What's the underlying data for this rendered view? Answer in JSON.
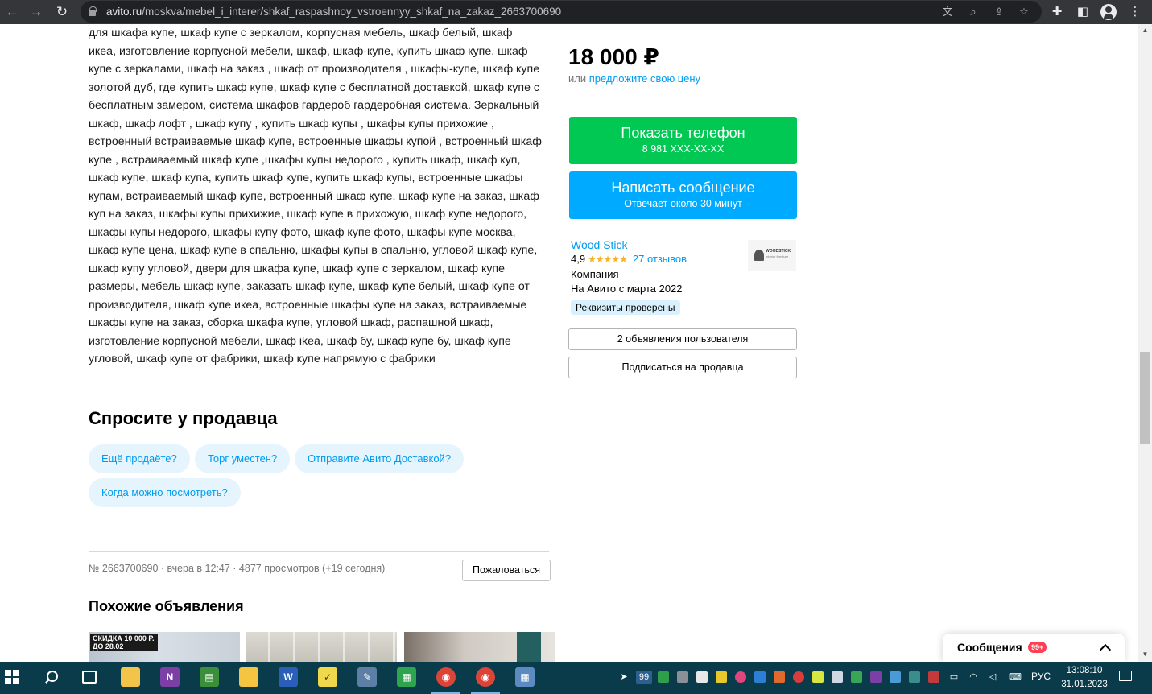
{
  "browser": {
    "url_host": "avito.ru",
    "url_path": "/moskva/mebel_i_interer/shkaf_raspashnoy_vstroennyy_shkaf_na_zakaz_2663700690",
    "icons": [
      "back-arrow-icon",
      "forward-arrow-icon",
      "reload-icon",
      "lock-icon",
      "translate-icon",
      "zoom-icon",
      "share-icon",
      "star-icon",
      "extensions-icon",
      "sidebar-icon",
      "profile-icon",
      "menu-icon"
    ]
  },
  "description": {
    "lines": [
      "для шкафа купе, шкаф купе с зеркалом, корпусная мебель, шкаф белый, шкаф",
      "икеа, изготовление корпусной мебели, шкаф, шкаф-купе, купить шкаф купе, шкаф",
      "купе с зеркалами, шкаф на заказ , шкаф от производителя , шкафы-купе, шкаф купе",
      "золотой дуб, где купить шкаф купе, шкаф купе с бесплатной доставкой, шкаф купе с",
      "бесплатным замером, система шкафов гардероб гардеробная система. Зеркальный",
      "шкаф, шкаф лофт , шкаф купу , купить шкаф купы , шкафы купы прихожие ,",
      "встроенный встраиваемые шкаф купе, встроенные шкафы купой , встроенный шкаф",
      "купе , встраиваемый шкаф купе ,шкафы купы недорого , купить шкаф, шкаф куп,",
      "шкаф купе, шкаф купа, купить шкаф купе, купить шкаф купы, встроенные шкафы",
      "купам, встраиваемый шкаф купе, встроенный шкаф купе, шкаф купе на заказ, шкаф",
      "куп на заказ, шкафы купы прихижие, шкаф купе в прихожую, шкаф купе недорого,",
      "шкафы купы недорого, шкафы купу фото, шкаф купе фото, шкафы купе москва,",
      "шкаф купе цена, шкаф купе в спальню, шкафы купы в спальню, угловой шкаф купе,",
      "шкаф купу угловой, двери для шкафа купе, шкаф купе с зеркалом, шкаф купе",
      "размеры, мебель шкаф купе, заказать шкаф купе, шкаф купе белый, шкаф купе от",
      "производителя, шкаф купе икеа, встроенные шкафы купе на заказ, встраиваемые",
      "шкафы купе на заказ, сборка шкафа купе, угловой шкаф, распашной шкаф,",
      "изготовление корпусной мебели, шкаф ikea, шкаф бу, шкаф купе бу, шкаф купе",
      "угловой, шкаф купе от фабрики, шкаф купе напрямую с фабрики"
    ]
  },
  "ask_seller": {
    "title": "Спросите у продавца",
    "chips": [
      "Ещё продаёте?",
      "Торг уместен?",
      "Отправите Авито Доставкой?",
      "Когда можно посмотреть?"
    ]
  },
  "ad_meta": {
    "text": "№ 2663700690 · вчера в 12:47 · 4877 просмотров (+19 сегодня)",
    "complain_label": "Пожаловаться"
  },
  "similar": {
    "title": "Похожие объявления",
    "discount_badge_line1": "СКИДКА 10 000 Р.",
    "discount_badge_line2": "ДО 28.02"
  },
  "price": {
    "value": "18 000 ₽",
    "or": "или",
    "offer_link": "предложите свою цену"
  },
  "contact": {
    "phone_label": "Показать телефон",
    "phone_masked": "8 981 XXX-XX-XX",
    "message_label": "Написать сообщение",
    "message_sub": "Отвечает около 30 минут"
  },
  "seller": {
    "name": "Wood Stick",
    "rating": "4,9",
    "stars": "★★★★★",
    "reviews": "27 отзывов",
    "type": "Компания",
    "since": "На Авито с марта 2022",
    "verified": "Реквизиты проверены",
    "logo_text": "WOODSTICK",
    "logo_tagline": "Interior furniture",
    "listings_button": "2 объявления пользователя",
    "subscribe_button": "Подписаться на продавца"
  },
  "messages_widget": {
    "label": "Сообщения",
    "badge": "99+"
  },
  "taskbar": {
    "apps": [
      "file-explorer",
      "onenote",
      "spreadsheet-editor",
      "folder",
      "word",
      "sticky-notes",
      "paint",
      "sheets",
      "chrome",
      "chrome-profile",
      "calculator"
    ],
    "tray_count": "99",
    "language": "РУС",
    "time": "13:08:10",
    "date": "31.01.2023"
  }
}
